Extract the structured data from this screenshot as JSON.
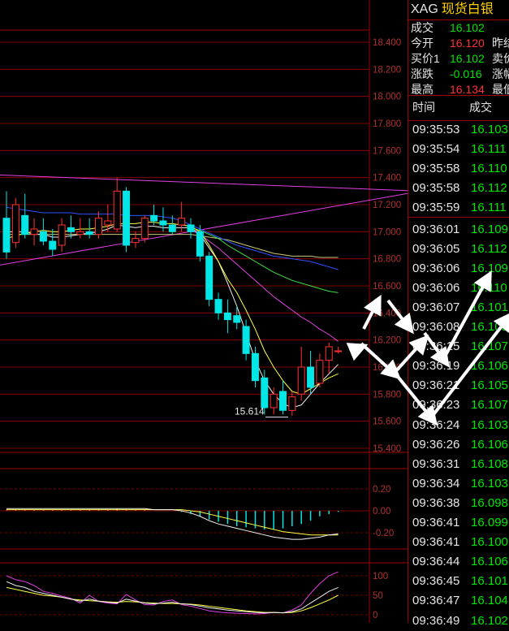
{
  "chart_data": {
    "type": "candlestick",
    "y_ticks": [
      "18.400",
      "18.200",
      "18.000",
      "17.800",
      "17.600",
      "17.400",
      "17.200",
      "17.000",
      "16.800",
      "16.600",
      "16.400",
      "16.200",
      "16.000",
      "15.800",
      "15.600",
      "15.400"
    ],
    "y_range": [
      15.4,
      18.4
    ],
    "annotation_low": "15.614",
    "candles": [
      {
        "o": 17.1,
        "h": 17.3,
        "l": 16.8,
        "c": 16.85
      },
      {
        "o": 16.92,
        "h": 17.25,
        "l": 16.88,
        "c": 17.2
      },
      {
        "o": 17.12,
        "h": 17.28,
        "l": 16.95,
        "c": 16.98
      },
      {
        "o": 16.98,
        "h": 17.1,
        "l": 16.9,
        "c": 17.02
      },
      {
        "o": 17.0,
        "h": 17.1,
        "l": 16.9,
        "c": 16.93
      },
      {
        "o": 16.93,
        "h": 17.02,
        "l": 16.82,
        "c": 16.87
      },
      {
        "o": 16.9,
        "h": 17.1,
        "l": 16.85,
        "c": 17.05
      },
      {
        "o": 17.03,
        "h": 17.12,
        "l": 16.95,
        "c": 17.0
      },
      {
        "o": 16.98,
        "h": 17.1,
        "l": 16.95,
        "c": 17.0
      },
      {
        "o": 17.0,
        "h": 17.1,
        "l": 16.95,
        "c": 16.98
      },
      {
        "o": 16.98,
        "h": 17.15,
        "l": 16.95,
        "c": 17.1
      },
      {
        "o": 17.05,
        "h": 17.2,
        "l": 17.0,
        "c": 17.08
      },
      {
        "o": 17.02,
        "h": 17.4,
        "l": 17.0,
        "c": 17.3
      },
      {
        "o": 17.3,
        "h": 17.33,
        "l": 16.85,
        "c": 16.9
      },
      {
        "o": 16.92,
        "h": 17.0,
        "l": 16.88,
        "c": 16.95
      },
      {
        "o": 16.95,
        "h": 17.12,
        "l": 16.92,
        "c": 17.1
      },
      {
        "o": 17.12,
        "h": 17.2,
        "l": 17.05,
        "c": 17.08
      },
      {
        "o": 17.08,
        "h": 17.18,
        "l": 17.0,
        "c": 17.05
      },
      {
        "o": 17.05,
        "h": 17.12,
        "l": 16.98,
        "c": 17.0
      },
      {
        "o": 17.05,
        "h": 17.22,
        "l": 17.0,
        "c": 17.1
      },
      {
        "o": 17.05,
        "h": 17.1,
        "l": 16.95,
        "c": 17.0
      },
      {
        "o": 17.0,
        "h": 17.05,
        "l": 16.78,
        "c": 16.82
      },
      {
        "o": 16.82,
        "h": 16.85,
        "l": 16.45,
        "c": 16.5
      },
      {
        "o": 16.5,
        "h": 16.55,
        "l": 16.35,
        "c": 16.4
      },
      {
        "o": 16.4,
        "h": 16.5,
        "l": 16.25,
        "c": 16.35
      },
      {
        "o": 16.38,
        "h": 16.45,
        "l": 16.28,
        "c": 16.33
      },
      {
        "o": 16.3,
        "h": 16.35,
        "l": 16.05,
        "c": 16.1
      },
      {
        "o": 16.1,
        "h": 16.15,
        "l": 15.85,
        "c": 15.9
      },
      {
        "o": 15.92,
        "h": 15.98,
        "l": 15.65,
        "c": 15.7
      },
      {
        "o": 15.7,
        "h": 15.85,
        "l": 15.65,
        "c": 15.8
      },
      {
        "o": 15.82,
        "h": 15.9,
        "l": 15.65,
        "c": 15.68
      },
      {
        "o": 15.68,
        "h": 15.82,
        "l": 15.64,
        "c": 15.78
      },
      {
        "o": 15.8,
        "h": 16.15,
        "l": 15.75,
        "c": 16.0
      },
      {
        "o": 16.0,
        "h": 16.12,
        "l": 15.8,
        "c": 15.85
      },
      {
        "o": 15.88,
        "h": 16.1,
        "l": 15.85,
        "c": 16.05
      },
      {
        "o": 16.05,
        "h": 16.18,
        "l": 15.95,
        "c": 16.15
      },
      {
        "o": 16.12,
        "h": 16.15,
        "l": 16.1,
        "c": 16.12
      }
    ],
    "ma_yellow": [
      16.95,
      16.97,
      16.99,
      17.0,
      17.01,
      17.0,
      17.0,
      17.01,
      17.02,
      17.02,
      17.03,
      17.04,
      17.06,
      17.06,
      17.06,
      17.07,
      17.07,
      17.06,
      17.06,
      17.05,
      17.04,
      17.0,
      16.9,
      16.78,
      16.65,
      16.55,
      16.42,
      16.28,
      16.12,
      16.0,
      15.9,
      15.82,
      15.8,
      15.84,
      15.88,
      15.92,
      15.95
    ],
    "ma_white": [
      17.0,
      17.0,
      17.0,
      16.98,
      16.98,
      16.96,
      16.96,
      16.97,
      16.98,
      16.99,
      17.0,
      17.02,
      17.05,
      17.04,
      17.03,
      17.04,
      17.04,
      17.03,
      17.03,
      17.03,
      17.03,
      16.98,
      16.88,
      16.78,
      16.62,
      16.45,
      16.25,
      16.05,
      15.9,
      15.8,
      15.73,
      15.7,
      15.72,
      15.8,
      15.88,
      15.95,
      16.02
    ],
    "ma_blue": [
      17.18,
      17.17,
      17.16,
      17.15,
      17.14,
      17.14,
      17.14,
      17.14,
      17.13,
      17.13,
      17.13,
      17.13,
      17.13,
      17.12,
      17.12,
      17.12,
      17.12,
      17.11,
      17.1,
      17.08,
      17.05,
      17.02,
      16.99,
      16.96,
      16.93,
      16.9,
      16.88,
      16.86,
      16.84,
      16.82,
      16.81,
      16.8,
      16.79,
      16.78,
      16.76,
      16.74,
      16.72
    ],
    "ma_olive": [
      16.98,
      16.98,
      16.98,
      16.98,
      16.98,
      16.98,
      16.98,
      16.98,
      16.98,
      16.98,
      16.98,
      16.98,
      16.98,
      16.98,
      16.98,
      16.98,
      16.98,
      16.98,
      16.98,
      16.98,
      16.98,
      16.97,
      16.96,
      16.95,
      16.94,
      16.92,
      16.9,
      16.88,
      16.86,
      16.84,
      16.83,
      16.82,
      16.82,
      16.82,
      16.81,
      16.81,
      16.81
    ],
    "ma_green": [
      null,
      null,
      null,
      null,
      null,
      null,
      null,
      null,
      null,
      null,
      null,
      null,
      null,
      null,
      null,
      null,
      null,
      null,
      null,
      null,
      17.03,
      17.01,
      16.98,
      16.95,
      16.9,
      16.86,
      16.82,
      16.78,
      16.74,
      16.7,
      16.67,
      16.64,
      16.62,
      16.6,
      16.58,
      16.56,
      16.55
    ],
    "ma_magenta": [
      null,
      null,
      null,
      null,
      null,
      null,
      null,
      null,
      null,
      null,
      null,
      null,
      null,
      null,
      null,
      null,
      null,
      null,
      null,
      null,
      17.01,
      16.98,
      16.93,
      16.88,
      16.82,
      16.76,
      16.7,
      16.64,
      16.58,
      16.52,
      16.47,
      16.42,
      16.37,
      16.33,
      16.28,
      16.24,
      16.19
    ],
    "trendline_upper": {
      "from": [
        -1,
        17.42
      ],
      "to": [
        45,
        17.3
      ]
    },
    "trendline_lower": {
      "from": [
        -1,
        16.75
      ],
      "to": [
        45,
        17.3
      ]
    },
    "macd": {
      "y_ticks": [
        "0.20",
        "0.00",
        "-0.20"
      ],
      "y_range": [
        -0.32,
        0.3
      ],
      "dif": [
        0.02,
        0.02,
        0.02,
        0.02,
        0.02,
        0.02,
        0.02,
        0.02,
        0.02,
        0.02,
        0.02,
        0.02,
        0.02,
        0.02,
        0.02,
        0.02,
        0.01,
        0.01,
        0.01,
        0.0,
        -0.02,
        -0.05,
        -0.09,
        -0.12,
        -0.14,
        -0.16,
        -0.18,
        -0.2,
        -0.22,
        -0.24,
        -0.25,
        -0.26,
        -0.26,
        -0.25,
        -0.24,
        -0.22,
        -0.21
      ],
      "dea": [
        0.01,
        0.01,
        0.01,
        0.01,
        0.01,
        0.01,
        0.01,
        0.01,
        0.01,
        0.01,
        0.01,
        0.01,
        0.01,
        0.01,
        0.01,
        0.01,
        0.01,
        0.01,
        0.01,
        0.01,
        0.0,
        -0.01,
        -0.03,
        -0.05,
        -0.07,
        -0.09,
        -0.11,
        -0.13,
        -0.15,
        -0.17,
        -0.19,
        -0.2,
        -0.21,
        -0.22,
        -0.22,
        -0.22,
        -0.22
      ],
      "hist": [
        0.01,
        0.01,
        0.01,
        0.01,
        0.01,
        0.01,
        0.01,
        0.01,
        0.01,
        0.01,
        0.01,
        0.01,
        0.02,
        0.01,
        0.01,
        0.01,
        0.0,
        0.0,
        0.0,
        -0.01,
        -0.03,
        -0.05,
        -0.08,
        -0.1,
        -0.12,
        -0.14,
        -0.15,
        -0.16,
        -0.17,
        -0.17,
        -0.16,
        -0.14,
        -0.12,
        -0.09,
        -0.05,
        -0.03,
        -0.01
      ]
    },
    "kdj": {
      "y_ticks": [
        "100",
        "50",
        "0"
      ],
      "y_range": [
        -5,
        115
      ],
      "k": [
        85,
        75,
        70,
        60,
        55,
        50,
        45,
        40,
        35,
        40,
        35,
        32,
        30,
        40,
        35,
        30,
        28,
        30,
        32,
        28,
        26,
        22,
        18,
        15,
        12,
        10,
        8,
        6,
        5,
        6,
        5,
        8,
        15,
        30,
        45,
        60,
        70
      ],
      "d": [
        70,
        65,
        60,
        55,
        50,
        48,
        45,
        40,
        38,
        36,
        35,
        33,
        32,
        34,
        33,
        31,
        30,
        29,
        29,
        28,
        27,
        25,
        22,
        19,
        16,
        13,
        10,
        8,
        6,
        6,
        5,
        6,
        10,
        18,
        28,
        38,
        50
      ],
      "j": [
        100,
        90,
        85,
        75,
        60,
        55,
        48,
        42,
        30,
        50,
        34,
        30,
        28,
        52,
        38,
        26,
        25,
        34,
        38,
        26,
        22,
        16,
        10,
        7,
        5,
        4,
        3,
        2,
        3,
        6,
        5,
        12,
        25,
        55,
        80,
        100,
        110
      ]
    }
  },
  "panel": {
    "code": "XAG",
    "name": "现货白银",
    "quote": [
      {
        "label": "成交",
        "value": "16.102",
        "value_color": "#00e600",
        "label2": ""
      },
      {
        "label": "今开",
        "value": "16.120",
        "value_color": "#ff3232",
        "label2": "昨结"
      },
      {
        "label": "买价1",
        "value": "16.102",
        "value_color": "#00e600",
        "label2": "卖价"
      },
      {
        "label": "涨跌",
        "value": "-0.016",
        "value_color": "#00e600",
        "label2": "涨幅"
      },
      {
        "label": "最高",
        "value": "16.134",
        "value_color": "#ff3232",
        "label2": "最低"
      }
    ],
    "table_header": {
      "time": "时间",
      "price": "成交"
    },
    "trades": [
      {
        "time": "09:35:53",
        "price": "16.103",
        "color": "#00e600"
      },
      {
        "time": "09:35:54",
        "price": "16.111",
        "color": "#00e600"
      },
      {
        "time": "09:35:58",
        "price": "16.110",
        "color": "#00e600"
      },
      {
        "time": "09:35:58",
        "price": "16.112",
        "color": "#00e600"
      },
      {
        "time": "09:35:59",
        "price": "16.111",
        "color": "#00e600"
      },
      {
        "time": "09:36:01",
        "price": "16.109",
        "color": "#00e600"
      },
      {
        "time": "09:36:05",
        "price": "16.112",
        "color": "#00e600"
      },
      {
        "time": "09:36:06",
        "price": "16.109",
        "color": "#00e600"
      },
      {
        "time": "09:36:06",
        "price": "16.110",
        "color": "#00e600"
      },
      {
        "time": "09:36:07",
        "price": "16.101",
        "color": "#00e600"
      },
      {
        "time": "09:36:08",
        "price": "16.105",
        "color": "#00e600"
      },
      {
        "time": "09:36:15",
        "price": "16.107",
        "color": "#00e600"
      },
      {
        "time": "09:36:19",
        "price": "16.106",
        "color": "#00e600"
      },
      {
        "time": "09:36:21",
        "price": "16.105",
        "color": "#00e600"
      },
      {
        "time": "09:36:23",
        "price": "16.107",
        "color": "#00e600"
      },
      {
        "time": "09:36:24",
        "price": "16.103",
        "color": "#00e600"
      },
      {
        "time": "09:36:26",
        "price": "16.106",
        "color": "#00e600"
      },
      {
        "time": "09:36:31",
        "price": "16.108",
        "color": "#00e600"
      },
      {
        "time": "09:36:34",
        "price": "16.103",
        "color": "#00e600"
      },
      {
        "time": "09:36:38",
        "price": "16.098",
        "color": "#00e600"
      },
      {
        "time": "09:36:41",
        "price": "16.099",
        "color": "#00e600"
      },
      {
        "time": "09:36:41",
        "price": "16.100",
        "color": "#00e600"
      },
      {
        "time": "09:36:44",
        "price": "16.106",
        "color": "#00e600"
      },
      {
        "time": "09:36:45",
        "price": "16.101",
        "color": "#00e600"
      },
      {
        "time": "09:36:47",
        "price": "16.104",
        "color": "#00e600"
      },
      {
        "time": "09:36:49",
        "price": "16.102",
        "color": "#00e600"
      }
    ]
  },
  "colors": {
    "grid": "#a00000",
    "axis_text": "#b03030",
    "up": "#00e5e5",
    "down": "#ff3232",
    "arrow": "#ffffff"
  }
}
